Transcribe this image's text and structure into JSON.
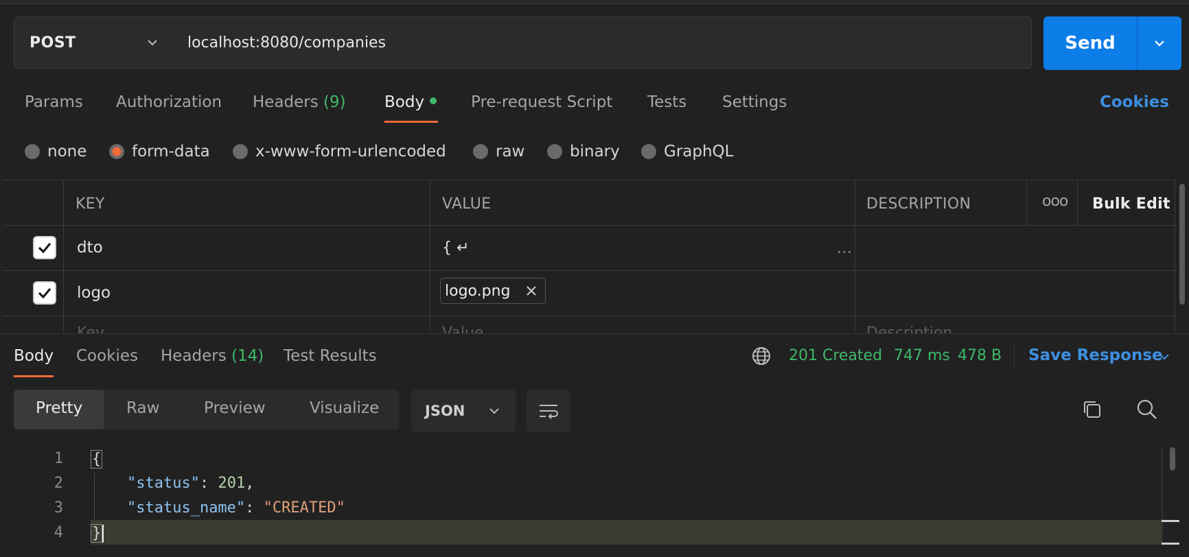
{
  "request": {
    "method": "POST",
    "url": "localhost:8080/companies",
    "send_label": "Send"
  },
  "req_tabs": {
    "params": "Params",
    "authorization": "Authorization",
    "headers": "Headers",
    "headers_count": "(9)",
    "body": "Body",
    "pre_request": "Pre-request Script",
    "tests": "Tests",
    "settings": "Settings",
    "cookies": "Cookies"
  },
  "body_types": [
    "none",
    "form-data",
    "x-www-form-urlencoded",
    "raw",
    "binary",
    "GraphQL"
  ],
  "selected_body_type": "form-data",
  "form_table": {
    "headers": {
      "key": "KEY",
      "value": "VALUE",
      "description": "DESCRIPTION",
      "more": "ooo",
      "bulk_edit": "Bulk Edit"
    },
    "rows": [
      {
        "key": "dto",
        "value": "{ ↵",
        "value_more": "...",
        "checked": true
      },
      {
        "key": "logo",
        "file": "logo.png",
        "checked": true
      }
    ],
    "placeholders": {
      "key": "Key",
      "value": "Value",
      "description": "Description"
    }
  },
  "response": {
    "tabs": {
      "body": "Body",
      "cookies": "Cookies",
      "headers": "Headers",
      "headers_count": "(14)",
      "test_results": "Test Results"
    },
    "status": "201 Created",
    "time": "747 ms",
    "size": "478 B",
    "save_label": "Save Response",
    "view_modes": [
      "Pretty",
      "Raw",
      "Preview",
      "Visualize"
    ],
    "format": "JSON",
    "lines": [
      {
        "num": "1",
        "open": "{"
      },
      {
        "num": "2",
        "key": "\"status\"",
        "colon": ": ",
        "num_val": "201",
        "comma": ","
      },
      {
        "num": "3",
        "key": "\"status_name\"",
        "colon": ": ",
        "str_val": "\"CREATED\""
      },
      {
        "num": "4",
        "close": "}"
      }
    ]
  },
  "colors": {
    "accent": "#f26b3a",
    "send": "#0d7de8",
    "success": "#3fb86a",
    "link": "#3d8fe0"
  }
}
